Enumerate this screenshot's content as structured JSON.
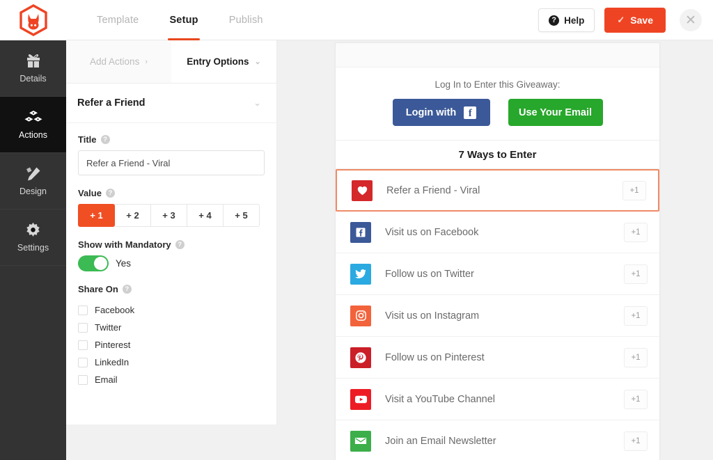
{
  "topbar": {
    "logo_name": "kingsumo-rabbit-logo",
    "tabs": [
      {
        "label": "Template",
        "active": false
      },
      {
        "label": "Setup",
        "active": true
      },
      {
        "label": "Publish",
        "active": false
      }
    ],
    "help_label": "Help",
    "help_icon": "question-mark-icon",
    "save_label": "Save",
    "save_icon": "checkmark-icon",
    "close_icon": "close-icon",
    "accent_color": "#ef4423"
  },
  "rail": {
    "items": [
      {
        "label": "Details",
        "icon": "gift-icon",
        "active": false
      },
      {
        "label": "Actions",
        "icon": "blocks-icon",
        "active": true
      },
      {
        "label": "Design",
        "icon": "pencil-ruler-icon",
        "active": false
      },
      {
        "label": "Settings",
        "icon": "gear-icon",
        "active": false
      }
    ]
  },
  "form": {
    "subtabs": [
      {
        "label": "Add Actions",
        "icon": "chevron-right-icon",
        "active": false
      },
      {
        "label": "Entry Options",
        "icon": "chevron-down-icon",
        "active": true
      }
    ],
    "section": {
      "title": "Refer a Friend",
      "collapse_icon": "chevron-down-icon"
    },
    "title_field": {
      "label": "Title",
      "help_icon": "help-circle-icon",
      "value": "Refer a Friend - Viral",
      "placeholder": "Refer a Friend - Viral"
    },
    "value_field": {
      "label": "Value",
      "help_icon": "help-circle-icon",
      "options": [
        "+ 1",
        "+ 2",
        "+ 3",
        "+ 4",
        "+ 5"
      ],
      "selected": "+ 1",
      "selected_color": "#f04e23"
    },
    "mandatory_field": {
      "label": "Show with Mandatory",
      "help_icon": "help-circle-icon",
      "toggle_state": "Yes",
      "toggle_on": true,
      "toggle_color": "#3cba54"
    },
    "share_field": {
      "label": "Share On",
      "help_icon": "help-circle-icon",
      "options": [
        {
          "label": "Facebook",
          "checked": false
        },
        {
          "label": "Twitter",
          "checked": false
        },
        {
          "label": "Pinterest",
          "checked": false
        },
        {
          "label": "LinkedIn",
          "checked": false
        },
        {
          "label": "Email",
          "checked": false
        }
      ]
    }
  },
  "preview": {
    "login_title": "Log In to Enter this Giveaway:",
    "facebook_button": {
      "label": "Login with",
      "icon": "facebook-icon",
      "color": "#3b5998"
    },
    "email_button": {
      "label": "Use Your Email",
      "color": "#27a72b"
    },
    "ways_heading": "7 Ways to Enter",
    "entries": [
      {
        "label": "Refer a Friend - Viral",
        "points": "+1",
        "icon": "heart-icon",
        "color": "#d4282a",
        "highlighted": true
      },
      {
        "label": "Visit us on Facebook",
        "points": "+1",
        "icon": "facebook-icon",
        "color": "#3b5998",
        "highlighted": false
      },
      {
        "label": "Follow us on Twitter",
        "points": "+1",
        "icon": "twitter-icon",
        "color": "#2ba9e1",
        "highlighted": false
      },
      {
        "label": "Visit us on Instagram",
        "points": "+1",
        "icon": "instagram-icon",
        "color": "#f2633b",
        "highlighted": false
      },
      {
        "label": "Follow us on Pinterest",
        "points": "+1",
        "icon": "pinterest-icon",
        "color": "#cb1f27",
        "highlighted": false
      },
      {
        "label": "Visit a YouTube Channel",
        "points": "+1",
        "icon": "youtube-icon",
        "color": "#ed1c24",
        "highlighted": false
      },
      {
        "label": "Join an Email Newsletter",
        "points": "+1",
        "icon": "envelope-icon",
        "color": "#3cae4a",
        "highlighted": false
      }
    ],
    "highlight_color": "#ef8a66"
  }
}
